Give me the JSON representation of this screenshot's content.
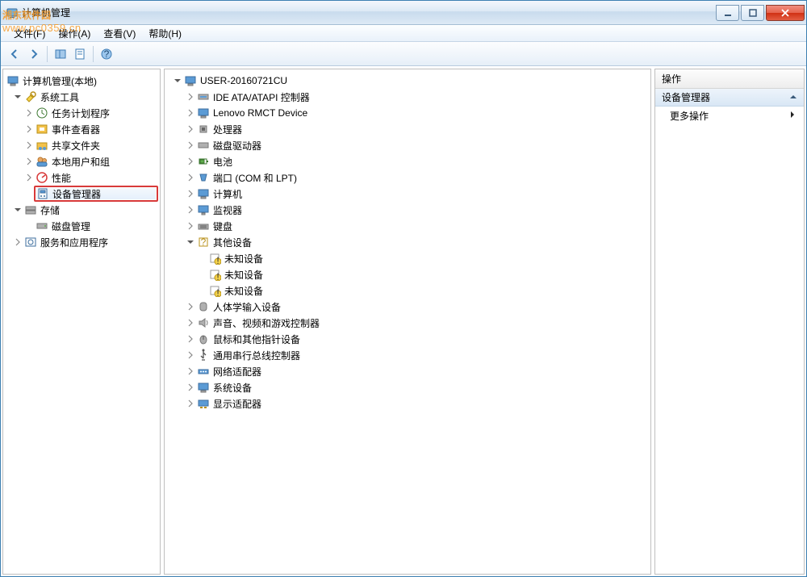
{
  "window": {
    "title": "计算机管理"
  },
  "watermark": {
    "brand": "湘东软件园",
    "url": "www.pc0359.cn"
  },
  "menu": {
    "file": "文件(F)",
    "action": "操作(A)",
    "view": "查看(V)",
    "help": "帮助(H)"
  },
  "left_tree": {
    "root": "计算机管理(本地)",
    "system_tools": "系统工具",
    "st_items": [
      "任务计划程序",
      "事件查看器",
      "共享文件夹",
      "本地用户和组",
      "性能",
      "设备管理器"
    ],
    "storage": "存储",
    "storage_item": "磁盘管理",
    "services": "服务和应用程序"
  },
  "device_tree": {
    "root": "USER-20160721CU",
    "items": [
      "IDE ATA/ATAPI 控制器",
      "Lenovo RMCT Device",
      "处理器",
      "磁盘驱动器",
      "电池",
      "端口 (COM 和 LPT)",
      "计算机",
      "监视器",
      "键盘"
    ],
    "other_devices": "其他设备",
    "unknown": "未知设备",
    "items2": [
      "人体学输入设备",
      "声音、视频和游戏控制器",
      "鼠标和其他指针设备",
      "通用串行总线控制器",
      "网络适配器",
      "系统设备",
      "显示适配器"
    ]
  },
  "actions": {
    "header": "操作",
    "section": "设备管理器",
    "more": "更多操作"
  }
}
